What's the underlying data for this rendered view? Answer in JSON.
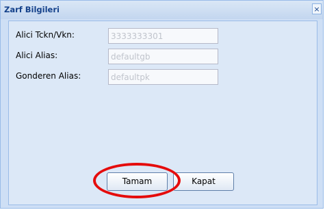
{
  "window": {
    "title": "Zarf Bilgileri",
    "close_symbol": "×"
  },
  "form": {
    "fields": [
      {
        "label": "Alici Tckn/Vkn:",
        "value": "3333333301"
      },
      {
        "label": "Alici Alias:",
        "value": "defaultgb"
      },
      {
        "label": "Gonderen Alias:",
        "value": "defaultpk"
      }
    ]
  },
  "buttons": {
    "ok_label": "Tamam",
    "close_label": "Kapat"
  },
  "annotation": {
    "color": "#e50c0c",
    "target": "ok-button"
  }
}
